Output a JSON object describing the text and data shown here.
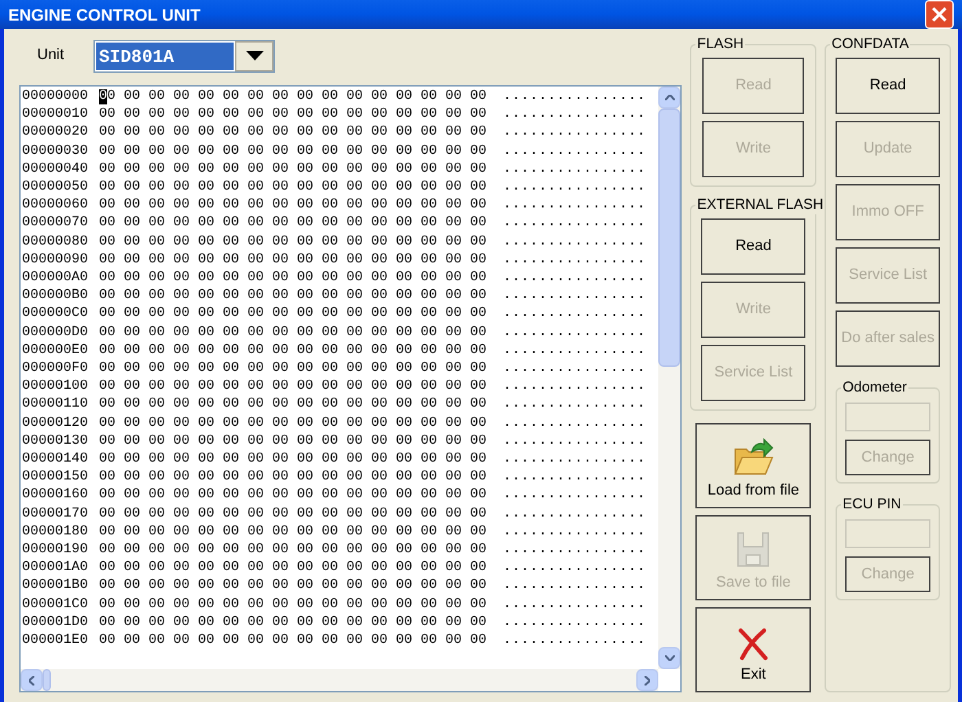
{
  "window": {
    "title": "ENGINE CONTROL UNIT"
  },
  "unit": {
    "label": "Unit",
    "value": "SID801A"
  },
  "hex_view": {
    "rows": [
      {
        "address": "00000000",
        "cursor": true,
        "bytes": "00 00 00 00 00 00 00 00 00 00 00 00 00 00 00 00",
        "ascii": "................"
      },
      {
        "address": "00000010",
        "bytes": "00 00 00 00 00 00 00 00 00 00 00 00 00 00 00 00",
        "ascii": "................"
      },
      {
        "address": "00000020",
        "bytes": "00 00 00 00 00 00 00 00 00 00 00 00 00 00 00 00",
        "ascii": "................"
      },
      {
        "address": "00000030",
        "bytes": "00 00 00 00 00 00 00 00 00 00 00 00 00 00 00 00",
        "ascii": "................"
      },
      {
        "address": "00000040",
        "bytes": "00 00 00 00 00 00 00 00 00 00 00 00 00 00 00 00",
        "ascii": "................"
      },
      {
        "address": "00000050",
        "bytes": "00 00 00 00 00 00 00 00 00 00 00 00 00 00 00 00",
        "ascii": "................"
      },
      {
        "address": "00000060",
        "bytes": "00 00 00 00 00 00 00 00 00 00 00 00 00 00 00 00",
        "ascii": "................"
      },
      {
        "address": "00000070",
        "bytes": "00 00 00 00 00 00 00 00 00 00 00 00 00 00 00 00",
        "ascii": "................"
      },
      {
        "address": "00000080",
        "bytes": "00 00 00 00 00 00 00 00 00 00 00 00 00 00 00 00",
        "ascii": "................"
      },
      {
        "address": "00000090",
        "bytes": "00 00 00 00 00 00 00 00 00 00 00 00 00 00 00 00",
        "ascii": "................"
      },
      {
        "address": "000000A0",
        "bytes": "00 00 00 00 00 00 00 00 00 00 00 00 00 00 00 00",
        "ascii": "................"
      },
      {
        "address": "000000B0",
        "bytes": "00 00 00 00 00 00 00 00 00 00 00 00 00 00 00 00",
        "ascii": "................"
      },
      {
        "address": "000000C0",
        "bytes": "00 00 00 00 00 00 00 00 00 00 00 00 00 00 00 00",
        "ascii": "................"
      },
      {
        "address": "000000D0",
        "bytes": "00 00 00 00 00 00 00 00 00 00 00 00 00 00 00 00",
        "ascii": "................"
      },
      {
        "address": "000000E0",
        "bytes": "00 00 00 00 00 00 00 00 00 00 00 00 00 00 00 00",
        "ascii": "................"
      },
      {
        "address": "000000F0",
        "bytes": "00 00 00 00 00 00 00 00 00 00 00 00 00 00 00 00",
        "ascii": "................"
      },
      {
        "address": "00000100",
        "bytes": "00 00 00 00 00 00 00 00 00 00 00 00 00 00 00 00",
        "ascii": "................"
      },
      {
        "address": "00000110",
        "bytes": "00 00 00 00 00 00 00 00 00 00 00 00 00 00 00 00",
        "ascii": "................"
      },
      {
        "address": "00000120",
        "bytes": "00 00 00 00 00 00 00 00 00 00 00 00 00 00 00 00",
        "ascii": "................"
      },
      {
        "address": "00000130",
        "bytes": "00 00 00 00 00 00 00 00 00 00 00 00 00 00 00 00",
        "ascii": "................"
      },
      {
        "address": "00000140",
        "bytes": "00 00 00 00 00 00 00 00 00 00 00 00 00 00 00 00",
        "ascii": "................"
      },
      {
        "address": "00000150",
        "bytes": "00 00 00 00 00 00 00 00 00 00 00 00 00 00 00 00",
        "ascii": "................"
      },
      {
        "address": "00000160",
        "bytes": "00 00 00 00 00 00 00 00 00 00 00 00 00 00 00 00",
        "ascii": "................"
      },
      {
        "address": "00000170",
        "bytes": "00 00 00 00 00 00 00 00 00 00 00 00 00 00 00 00",
        "ascii": "................"
      },
      {
        "address": "00000180",
        "bytes": "00 00 00 00 00 00 00 00 00 00 00 00 00 00 00 00",
        "ascii": "................"
      },
      {
        "address": "00000190",
        "bytes": "00 00 00 00 00 00 00 00 00 00 00 00 00 00 00 00",
        "ascii": "................"
      },
      {
        "address": "000001A0",
        "bytes": "00 00 00 00 00 00 00 00 00 00 00 00 00 00 00 00",
        "ascii": "................"
      },
      {
        "address": "000001B0",
        "bytes": "00 00 00 00 00 00 00 00 00 00 00 00 00 00 00 00",
        "ascii": "................"
      },
      {
        "address": "000001C0",
        "bytes": "00 00 00 00 00 00 00 00 00 00 00 00 00 00 00 00",
        "ascii": "................"
      },
      {
        "address": "000001D0",
        "bytes": "00 00 00 00 00 00 00 00 00 00 00 00 00 00 00 00",
        "ascii": "................"
      },
      {
        "address": "000001E0",
        "bytes": "00 00 00 00 00 00 00 00 00 00 00 00 00 00 00 00",
        "ascii": "................"
      }
    ]
  },
  "flash": {
    "title": "FLASH",
    "buttons": [
      {
        "label": "Read",
        "disabled": true
      },
      {
        "label": "Write",
        "disabled": true
      }
    ]
  },
  "external_flash": {
    "title": "EXTERNAL FLASH",
    "buttons": [
      {
        "label": "Read",
        "disabled": false
      },
      {
        "label": "Write",
        "disabled": true
      },
      {
        "label": "Service List",
        "disabled": true
      }
    ]
  },
  "file_buttons": [
    {
      "kind": "load",
      "label": "Load from file",
      "disabled": false
    },
    {
      "kind": "save",
      "label": "Save to file",
      "disabled": true
    },
    {
      "kind": "exit",
      "label": "Exit",
      "disabled": false
    }
  ],
  "confdata": {
    "title": "CONFDATA",
    "buttons": [
      {
        "label": "Read",
        "disabled": false
      },
      {
        "label": "Update",
        "disabled": true
      },
      {
        "label": "Immo OFF",
        "disabled": true
      },
      {
        "label": "Service List",
        "disabled": true
      },
      {
        "label": "Do after sales",
        "disabled": true
      }
    ]
  },
  "odometer": {
    "title": "Odometer",
    "button": {
      "label": "Change",
      "disabled": true
    }
  },
  "ecu_pin": {
    "title": "ECU PIN",
    "button": {
      "label": "Change",
      "disabled": true
    }
  }
}
